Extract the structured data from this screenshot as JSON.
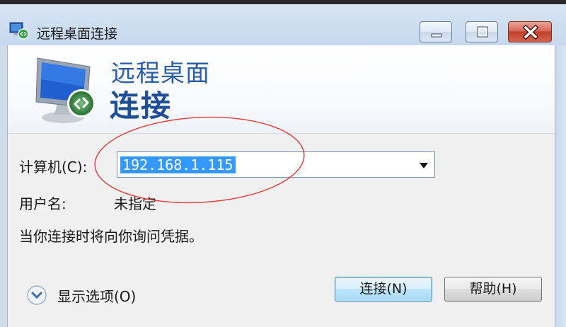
{
  "window": {
    "title": "远程桌面连接",
    "icon": "remote-desktop-icon",
    "controls": [
      "minimize",
      "maximize",
      "close"
    ]
  },
  "header": {
    "line1": "远程桌面",
    "line2": "连接",
    "icon": "monitor-connection-icon"
  },
  "form": {
    "computer_label": "计算机(C):",
    "computer_value": "192.168.1.115",
    "username_label": "用户名:",
    "username_value": "未指定",
    "info_text": "当你连接时将向你询问凭据。"
  },
  "footer": {
    "options_label": "显示选项(O)",
    "connect_label": "连接(N)",
    "help_label": "帮助(H)"
  },
  "colors": {
    "header_text": "#2a5fa8",
    "selection": "#3399ff",
    "annotation": "#e03a3a"
  }
}
